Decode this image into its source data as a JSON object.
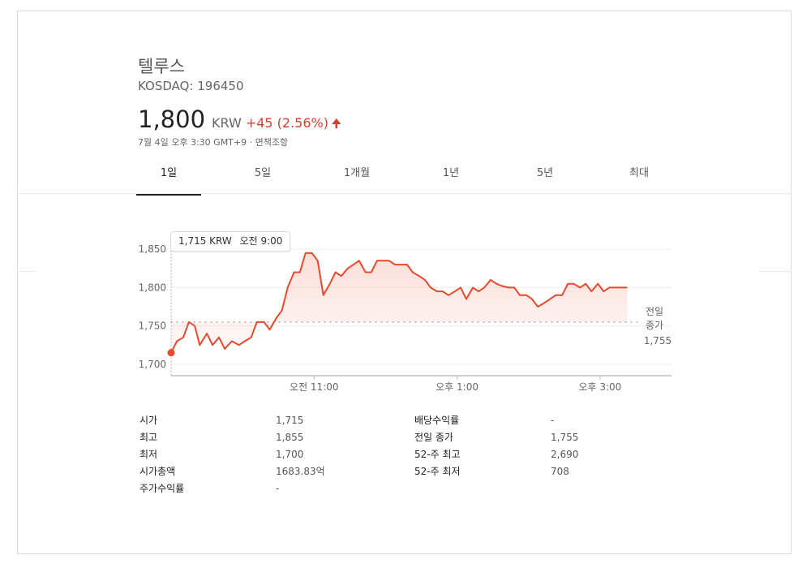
{
  "stock": {
    "name": "텔루스",
    "exchange_ticker": "KOSDAQ: 196450",
    "price": "1,800",
    "currency": "KRW",
    "change": "+45 (2.56%)",
    "direction_icon": "arrow-up-icon",
    "timestamp": "7월 4일 오후 3:30 GMT+9 · 면책조항"
  },
  "tabs": [
    {
      "label": "1일",
      "active": true
    },
    {
      "label": "5일",
      "active": false
    },
    {
      "label": "1개월",
      "active": false
    },
    {
      "label": "1년",
      "active": false
    },
    {
      "label": "5년",
      "active": false
    },
    {
      "label": "최대",
      "active": false
    }
  ],
  "tooltip": {
    "price": "1,715 KRW",
    "time": "오전 9:00"
  },
  "chart_data": {
    "type": "area",
    "y_tick_labels": [
      "1,850",
      "1,800",
      "1,750",
      "1,700"
    ],
    "y_ticks": [
      1850,
      1800,
      1750,
      1700
    ],
    "ylim": [
      1685,
      1865
    ],
    "x_tick_labels": [
      "오전 11:00",
      "오후 1:00",
      "오후 3:00"
    ],
    "x_tick_times": [
      11,
      13,
      15
    ],
    "xlim": [
      9,
      16
    ],
    "reference_line": {
      "label_line1": "전일",
      "label_line2": "종가",
      "value_label": "1,755",
      "value": 1755
    },
    "colors": {
      "line": "#e8492b",
      "marker": "#e8492b",
      "grid": "#eeeeee",
      "axis": "#bdbdbd",
      "reference": "#999999"
    },
    "series": [
      {
        "values": [
          [
            9.0,
            1715
          ],
          [
            9.08,
            1730
          ],
          [
            9.17,
            1735
          ],
          [
            9.25,
            1755
          ],
          [
            9.33,
            1750
          ],
          [
            9.4,
            1725
          ],
          [
            9.5,
            1740
          ],
          [
            9.58,
            1725
          ],
          [
            9.67,
            1735
          ],
          [
            9.75,
            1720
          ],
          [
            9.85,
            1730
          ],
          [
            9.95,
            1725
          ],
          [
            10.03,
            1730
          ],
          [
            10.12,
            1735
          ],
          [
            10.2,
            1755
          ],
          [
            10.3,
            1755
          ],
          [
            10.38,
            1745
          ],
          [
            10.47,
            1760
          ],
          [
            10.55,
            1770
          ],
          [
            10.63,
            1800
          ],
          [
            10.72,
            1820
          ],
          [
            10.8,
            1820
          ],
          [
            10.88,
            1845
          ],
          [
            10.97,
            1845
          ],
          [
            11.05,
            1835
          ],
          [
            11.13,
            1790
          ],
          [
            11.22,
            1805
          ],
          [
            11.3,
            1820
          ],
          [
            11.38,
            1815
          ],
          [
            11.47,
            1825
          ],
          [
            11.55,
            1830
          ],
          [
            11.63,
            1835
          ],
          [
            11.72,
            1820
          ],
          [
            11.8,
            1820
          ],
          [
            11.88,
            1835
          ],
          [
            11.97,
            1835
          ],
          [
            12.05,
            1835
          ],
          [
            12.13,
            1830
          ],
          [
            12.22,
            1830
          ],
          [
            12.3,
            1830
          ],
          [
            12.38,
            1820
          ],
          [
            12.47,
            1815
          ],
          [
            12.55,
            1810
          ],
          [
            12.63,
            1800
          ],
          [
            12.72,
            1795
          ],
          [
            12.8,
            1795
          ],
          [
            12.88,
            1790
          ],
          [
            12.97,
            1795
          ],
          [
            13.05,
            1800
          ],
          [
            13.13,
            1785
          ],
          [
            13.22,
            1800
          ],
          [
            13.3,
            1795
          ],
          [
            13.38,
            1800
          ],
          [
            13.47,
            1810
          ],
          [
            13.55,
            1805
          ],
          [
            13.63,
            1802
          ],
          [
            13.72,
            1800
          ],
          [
            13.8,
            1800
          ],
          [
            13.88,
            1790
          ],
          [
            13.97,
            1790
          ],
          [
            14.05,
            1785
          ],
          [
            14.13,
            1775
          ],
          [
            14.22,
            1780
          ],
          [
            14.3,
            1785
          ],
          [
            14.38,
            1790
          ],
          [
            14.47,
            1790
          ],
          [
            14.55,
            1805
          ],
          [
            14.63,
            1805
          ],
          [
            14.72,
            1800
          ],
          [
            14.8,
            1805
          ],
          [
            14.88,
            1795
          ],
          [
            14.97,
            1805
          ],
          [
            15.05,
            1795
          ],
          [
            15.13,
            1800
          ],
          [
            15.22,
            1800
          ],
          [
            15.3,
            1800
          ],
          [
            15.38,
            1800
          ]
        ]
      }
    ]
  },
  "stats": {
    "left": [
      {
        "label": "시가",
        "value": "1,715"
      },
      {
        "label": "최고",
        "value": "1,855"
      },
      {
        "label": "최저",
        "value": "1,700"
      },
      {
        "label": "시가총액",
        "value": "1683.83억"
      },
      {
        "label": "주가수익률",
        "value": "-"
      }
    ],
    "right": [
      {
        "label": "배당수익률",
        "value": "-"
      },
      {
        "label": "전일 종가",
        "value": "1,755"
      },
      {
        "label": "52-주 최고",
        "value": "2,690"
      },
      {
        "label": "52-주 최저",
        "value": "708"
      }
    ]
  }
}
